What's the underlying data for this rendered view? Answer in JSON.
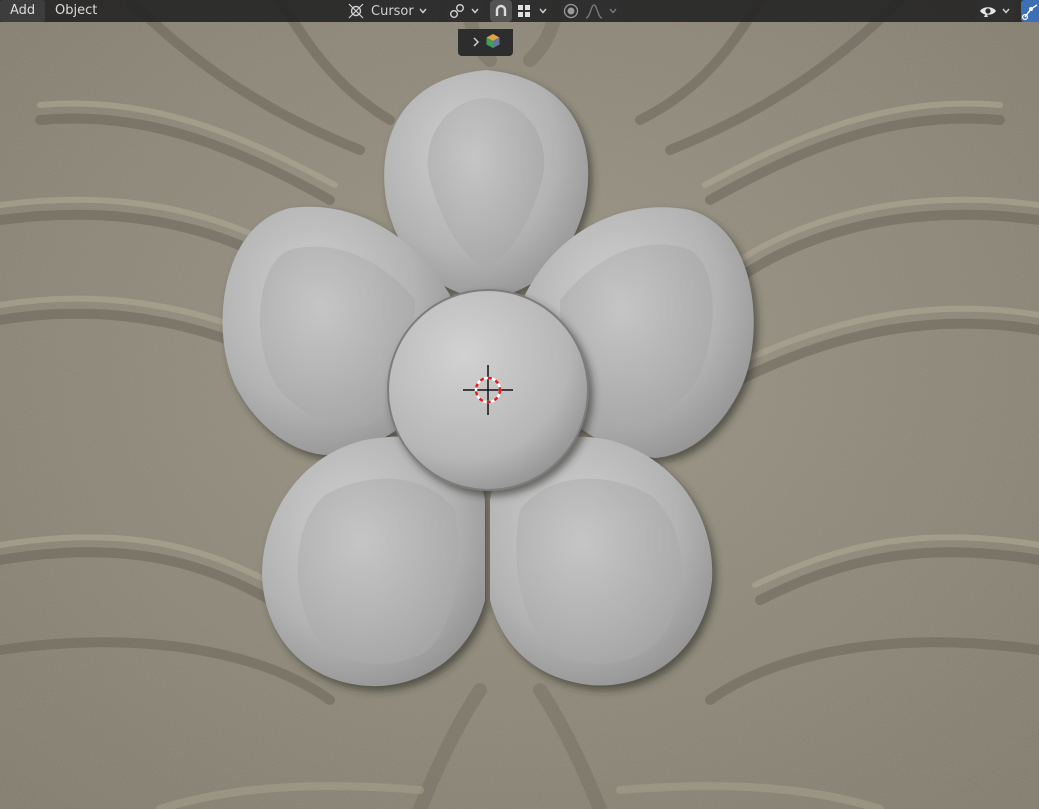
{
  "menu": {
    "add_label": "Add",
    "object_label": "Object"
  },
  "toolbar": {
    "pivot_label": "Cursor",
    "snapping_enabled": true,
    "proportional_editing_enabled": false
  },
  "icons": {
    "pivot": "pivot-cursor-icon",
    "link": "link-icon",
    "snap": "magnet-icon",
    "snap_target": "grid-snap-icon",
    "proportional": "proportional-circle-icon",
    "falloff": "falloff-curve-icon",
    "visibility": "eye-icon",
    "gizmo": "gizmo-icon",
    "collection": "collection-cube-icon",
    "cursor3d": "3d-cursor-icon"
  },
  "colors": {
    "header_bg": "#262626",
    "accent": "#3d6fb7",
    "relief_stone": "#8c8678",
    "flower_gray": "#b4b4b4"
  }
}
